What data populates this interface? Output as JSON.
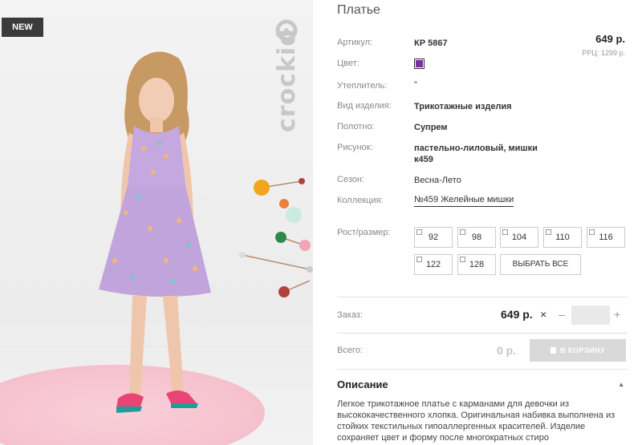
{
  "badge": "NEW",
  "brand": "crockid",
  "product": {
    "title": "Платье",
    "price": "649 р.",
    "rrp": "РРЦ: 1299 р.",
    "color_hex": "#7b2fa3",
    "attributes": [
      {
        "label": "Артикул:",
        "value": "КР 5867"
      },
      {
        "label": "Цвет:"
      },
      {
        "label": "Утеплитель:",
        "value": "\""
      },
      {
        "label": "Вид изделия:",
        "value": "Трикотажные изделия"
      },
      {
        "label": "Полотно:",
        "value": "Супрем"
      },
      {
        "label": "Рисунок:",
        "value_line1": "пастельно-лиловый, мишки",
        "value_line2": "к459"
      },
      {
        "label": "Сезон:",
        "value": "Весна-Лето"
      },
      {
        "label": "Коллекция:",
        "value": "№459 Желейные мишки"
      }
    ]
  },
  "sizes": {
    "label": "Рост/размер:",
    "options": [
      "92",
      "98",
      "104",
      "110",
      "116",
      "122",
      "128"
    ],
    "select_all": "ВЫБРАТЬ ВСЕ"
  },
  "order": {
    "label": "Заказ:",
    "price": "649 р.",
    "times": "×",
    "minus": "–",
    "plus": "+",
    "quantity": ""
  },
  "total": {
    "label": "Всего:",
    "value": "0 р.",
    "cart_button": "В КОРЗИНУ"
  },
  "description": {
    "title": "Описание",
    "toggle": "▲",
    "text": "Легкое трикотажное платье с карманами для девочки из высококачественного хлопка. Оригинальная набивка выполнена из стойких текстильных гипоаллергенных красителей. Изделие сохраняет цвет и форму после многократных стиро"
  }
}
